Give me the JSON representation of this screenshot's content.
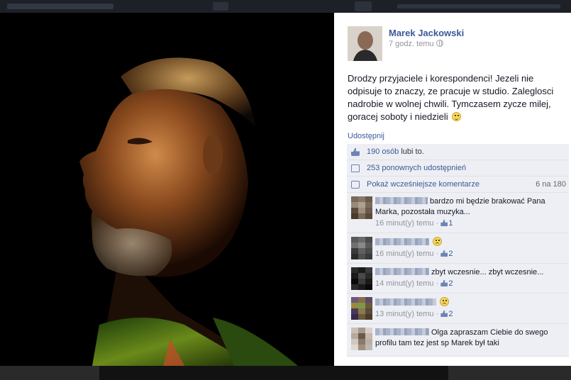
{
  "post": {
    "author": "Marek Jackowski",
    "time": "7 godz. temu",
    "text": "Drodzy przyjaciele i korespondenci! Jezeli nie odpisuje to znaczy, ze pracuje w studio. Zaleglosci nadrobie w wolnej chwili. Tymczasem zycze milej, goracej soboty i niedzieli",
    "share_label": "Udostępnij"
  },
  "stats": {
    "likes_link": "190 osób",
    "likes_suffix": "lubi to.",
    "shares": "253 ponownych udostępnień",
    "previous_comments": "Pokaż wcześniejsze komentarze",
    "comment_count": "6 na 180"
  },
  "comments": [
    {
      "text": "bardzo mi będzie brakować Pana Marka, pozostała muzyka...",
      "time": "16 minut(y) temu",
      "likes": "1",
      "emoji": ""
    },
    {
      "text": "",
      "time": "16 minut(y) temu",
      "likes": "2",
      "emoji": "sad-face"
    },
    {
      "text": "zbyt wczesnie... zbyt wczesnie...",
      "time": "14 minut(y) temu",
      "likes": "2",
      "emoji": ""
    },
    {
      "text": "",
      "time": "13 minut(y) temu",
      "likes": "2",
      "emoji": "sad-face"
    },
    {
      "text": "Olga zapraszam Ciebie do swego profilu tam tez jest sp Marek był taki",
      "time": "",
      "likes": "",
      "emoji": ""
    }
  ],
  "colors": {
    "link": "#3b5998",
    "ufi_bg": "#edeff4",
    "panel_bg": "#ffffff",
    "photo_bg": "#000000"
  }
}
